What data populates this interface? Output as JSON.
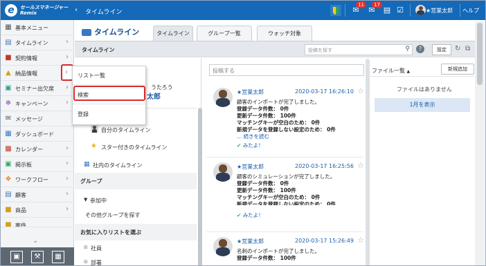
{
  "header": {
    "logo_line1": "セールスマネージャー",
    "logo_line2": "Remix",
    "back_icon": "chevron-left-icon",
    "title": "タイムライン",
    "notification_badge": "11",
    "mail_badge": "17",
    "user_name": "★営業太郎",
    "help_label": "ヘルプ"
  },
  "sidebar": {
    "menu_title": "基本メニュー",
    "items": [
      {
        "label": "タイムライン",
        "icon": "timeline-icon"
      },
      {
        "label": "契約情報",
        "icon": "contract-icon"
      },
      {
        "label": "納品情報",
        "icon": "delivery-icon"
      },
      {
        "label": "セミナー出欠席",
        "icon": "seminar-icon"
      },
      {
        "label": "キャンペーン",
        "icon": "campaign-icon"
      },
      {
        "label": "メッセージ",
        "icon": "message-icon"
      },
      {
        "label": "ダッシュボード",
        "icon": "dashboard-icon"
      },
      {
        "label": "カレンダー",
        "icon": "calendar-icon"
      },
      {
        "label": "掲示板",
        "icon": "board-icon"
      },
      {
        "label": "ワークフロー",
        "icon": "workflow-icon"
      },
      {
        "label": "顧客",
        "icon": "customer-icon"
      },
      {
        "label": "商品",
        "icon": "product-icon"
      },
      {
        "label": "案件",
        "icon": "project-icon"
      }
    ]
  },
  "dropdown": {
    "items": [
      "リスト一覧",
      "検索",
      "登録"
    ]
  },
  "main": {
    "heading": "タイムライン",
    "tabs": [
      "タイムライン",
      "グループ一覧",
      "ウォッチ対象"
    ],
    "subbar_label": "タイムライン",
    "search_placeholder": "投稿を探す",
    "settings_label": "設定",
    "profile_name_partial": "うたろう",
    "profile_link_partial": "太郎",
    "left_items": {
      "my_timeline": "自分のタイムライン",
      "starred_timeline": "スター付きのタイムライン",
      "company_timeline": "社内のタイムライン",
      "group_header": "グループ",
      "joined": "参加中",
      "find_other_groups": "その他グループを探す",
      "favorite_lists": "お気に入りリストを選ぶ",
      "employees": "社員",
      "departments": "部署"
    },
    "post_placeholder": "投稿する"
  },
  "posts": [
    {
      "author": "★営業太郎",
      "time": "2020-03-17 16:26:10",
      "lines": [
        "顧客のインポートが完了しました。",
        "登録データ件数： 0件",
        "更新データ件数： 100件",
        "マッチングキーが空白のため： 0件",
        "新規データを登録しない設定のため： 0件"
      ],
      "more": "... 続きを読む",
      "like": "みたよ！"
    },
    {
      "author": "★営業太郎",
      "time": "2020-03-17 16:25:56",
      "lines": [
        "顧客のシミュレーションが完了しました。",
        "登録データ件数： 0件",
        "更新データ件数： 100件",
        "マッチングキーが空白のため： 0件",
        "新規データを登録しない設定のため： 0件"
      ],
      "more": "",
      "like": "みたよ！"
    },
    {
      "author": "★営業太郎",
      "time": "2020-03-17 15:26:49",
      "lines": [
        "名刺のインポートが完了しました。",
        "登録データ件数： 100件"
      ],
      "more": "",
      "like": ""
    }
  ],
  "file_panel": {
    "title": "ファイル一覧",
    "new_button": "新規追加",
    "empty": "ファイルはありません",
    "month_button": "1月を表示"
  },
  "colors": {
    "header": "#1469b8",
    "accent": "#1a5ea8",
    "highlight": "#d62b2b"
  }
}
